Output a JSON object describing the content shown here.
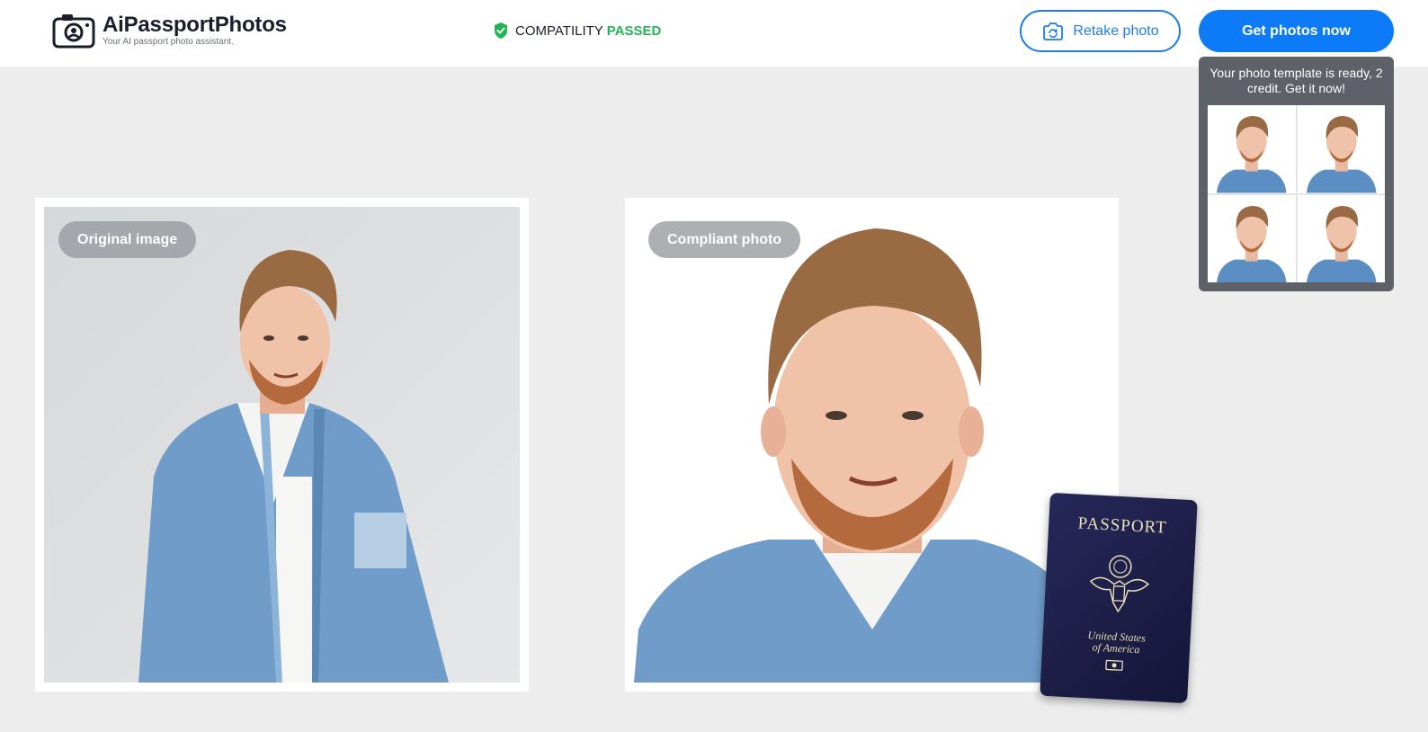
{
  "header": {
    "brand_name": "AiPassportPhotos",
    "brand_tagline": "Your AI passport photo assistant.",
    "compat_label": "COMPATILITY",
    "compat_status": "PASSED",
    "retake_label": "Retake photo",
    "get_photos_label": "Get photos now"
  },
  "popup": {
    "message": "Your photo template is ready, 2 credit. Get it now!",
    "thumbnail_count": 4
  },
  "panels": {
    "original_label": "Original image",
    "compliant_label": "Compliant photo"
  },
  "passport": {
    "title": "PASSPORT",
    "country_line1": "United States",
    "country_line2": "of America"
  },
  "colors": {
    "accent_blue": "#0d7bf7",
    "pass_green": "#22b455",
    "page_bg": "#ededed"
  },
  "icons": [
    "camera-logo-icon",
    "shield-check-icon",
    "camera-rotate-icon"
  ]
}
